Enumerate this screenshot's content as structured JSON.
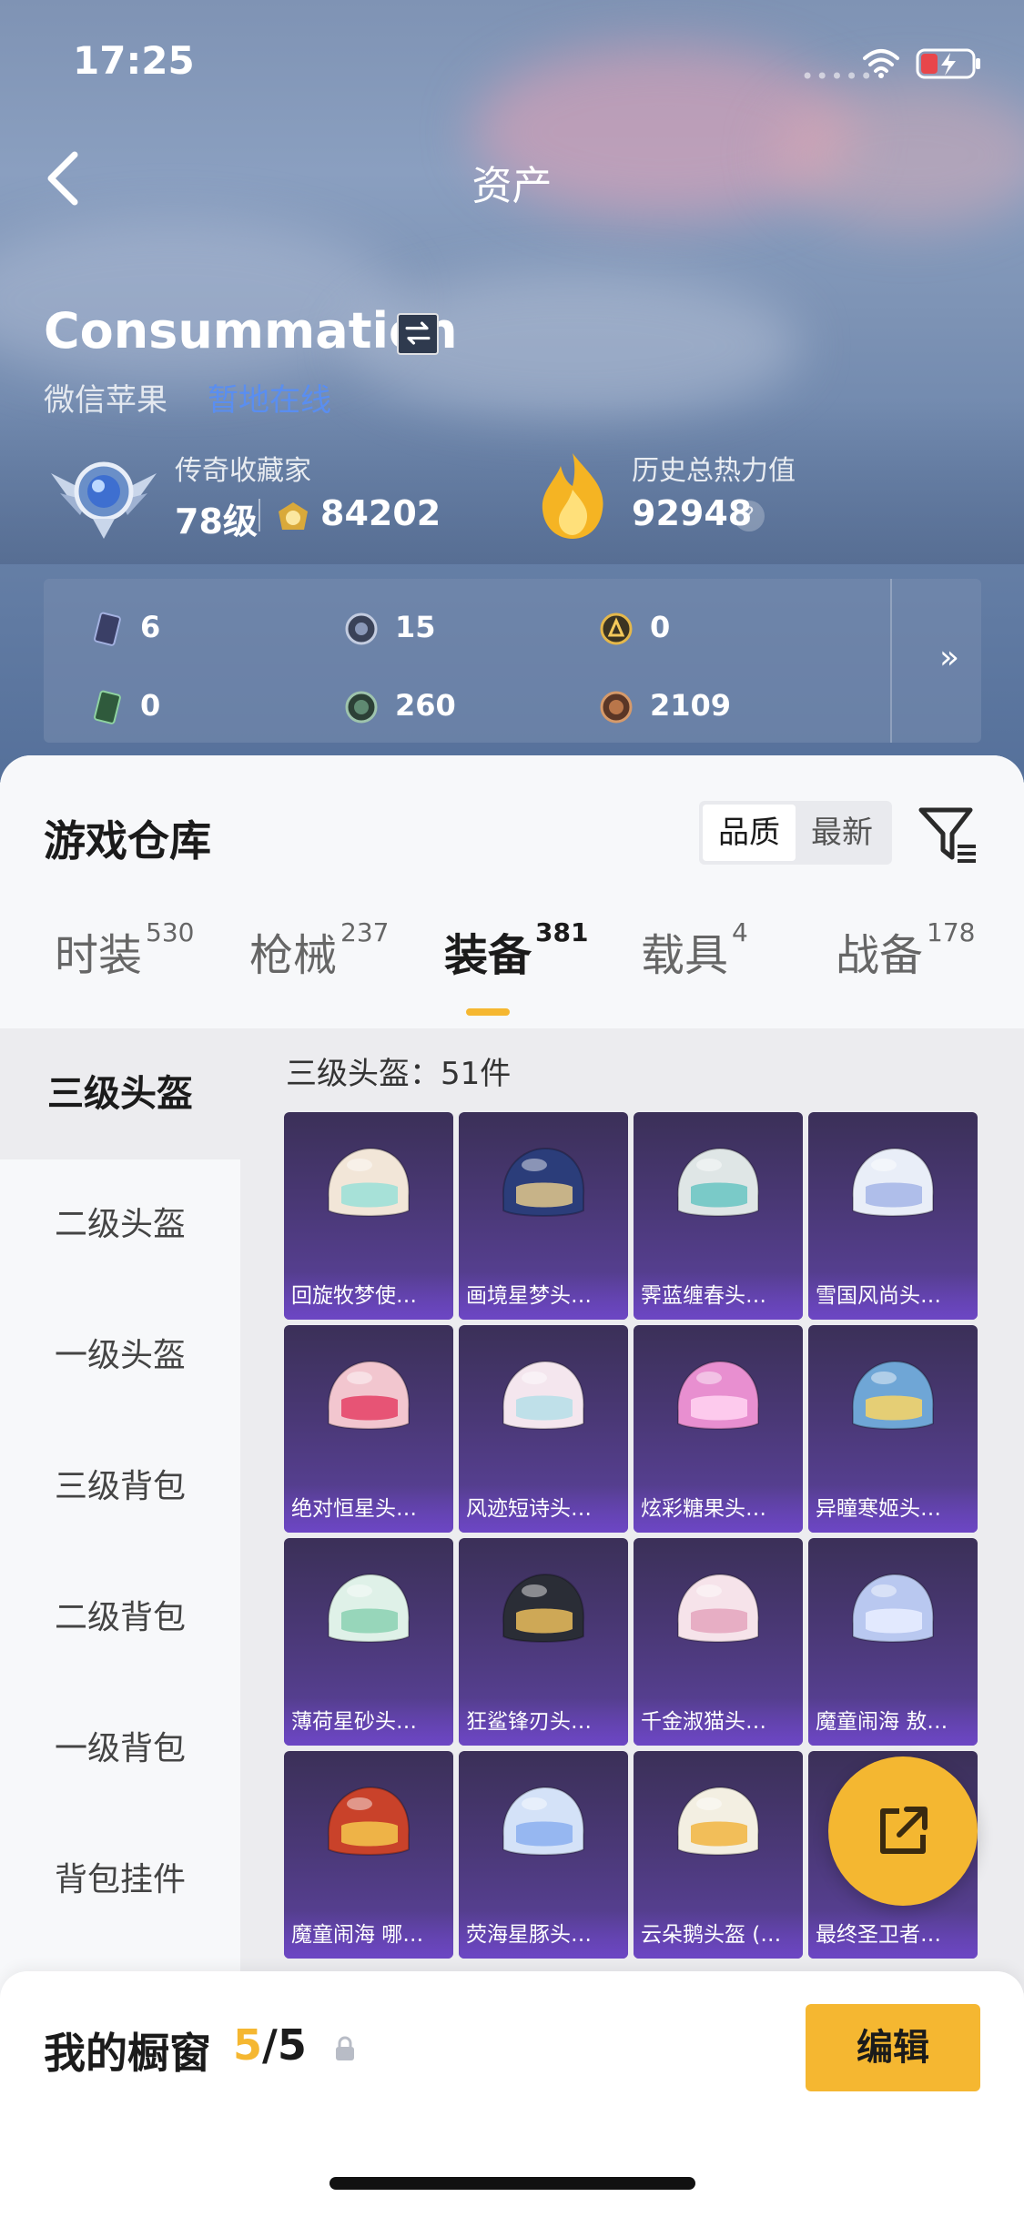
{
  "status": {
    "time": "17:25",
    "signal_dots": "•••••"
  },
  "header": {
    "title": "资产"
  },
  "profile": {
    "name": "Consummation",
    "platform": "微信苹果",
    "online_status": "暂地在线",
    "rank_title": "传奇收藏家",
    "level": "78级",
    "coins": "84202",
    "heat_title": "历史总热力值",
    "heat": "92948",
    "help": "?"
  },
  "currencies": [
    {
      "icon": "card-icon",
      "value": "6"
    },
    {
      "icon": "silver-coin-icon",
      "value": "15"
    },
    {
      "icon": "gold-badge-icon",
      "value": "0"
    },
    {
      "icon": "green-card-icon",
      "value": "0"
    },
    {
      "icon": "green-coin-icon",
      "value": "260"
    },
    {
      "icon": "bronze-coin-icon",
      "value": "2109"
    }
  ],
  "more": "»",
  "warehouse": {
    "title": "游戏仓库",
    "sort": [
      "品质",
      "最新"
    ],
    "tabs": [
      {
        "label": "时装",
        "count": "530"
      },
      {
        "label": "枪械",
        "count": "237"
      },
      {
        "label": "装备",
        "count": "381"
      },
      {
        "label": "载具",
        "count": "4"
      },
      {
        "label": "战备",
        "count": "178"
      }
    ],
    "categories": [
      "三级头盔",
      "二级头盔",
      "一级头盔",
      "三级背包",
      "二级背包",
      "一级背包",
      "背包挂件"
    ],
    "category_count": "三级头盔：51件",
    "items": [
      {
        "name": "回旋牧梦使…",
        "color": "#f2e6d8",
        "accent": "#9fe0d8"
      },
      {
        "name": "画境星梦头…",
        "color": "#2b3d7a",
        "accent": "#d8c08a"
      },
      {
        "name": "霁蓝缠春头…",
        "color": "#dfe6e6",
        "accent": "#6fc6c4"
      },
      {
        "name": "雪国风尚头…",
        "color": "#e9eef8",
        "accent": "#a9b8e8"
      },
      {
        "name": "绝对恒星头…",
        "color": "#f2c6cf",
        "accent": "#e6476a"
      },
      {
        "name": "风迹短诗头…",
        "color": "#f4e6ee",
        "accent": "#b9dfe8"
      },
      {
        "name": "炫彩糖果头…",
        "color": "#e88fd0",
        "accent": "#ffd0f0"
      },
      {
        "name": "异瞳寒姬头…",
        "color": "#6fa6d6",
        "accent": "#f2d36a"
      },
      {
        "name": "薄荷星砂头…",
        "color": "#dff1e8",
        "accent": "#8fd3b5"
      },
      {
        "name": "狂鲨锋刃头…",
        "color": "#2a2d36",
        "accent": "#e0b65a"
      },
      {
        "name": "千金淑猫头…",
        "color": "#f6e3ea",
        "accent": "#e6a7c0"
      },
      {
        "name": "魔童闹海 敖…",
        "color": "#b9c8f0",
        "accent": "#e7ecff"
      },
      {
        "name": "魔童闹海 哪…",
        "color": "#c9422a",
        "accent": "#f2c04a"
      },
      {
        "name": "荧海星豚头…",
        "color": "#d4e2f8",
        "accent": "#8fb3ef"
      },
      {
        "name": "云朵鹅头盔 (…",
        "color": "#f3efe2",
        "accent": "#f2b84a"
      },
      {
        "name": "最终圣卫者…",
        "color": "#cfd6e6",
        "accent": "#7c8fb5"
      }
    ]
  },
  "showcase": {
    "title": "我的橱窗",
    "current": "5",
    "total": "/5",
    "edit": "编辑"
  },
  "colors": {
    "accent": "#f5b731",
    "card_bg": "#4a3876",
    "online": "#5a8ef0"
  }
}
